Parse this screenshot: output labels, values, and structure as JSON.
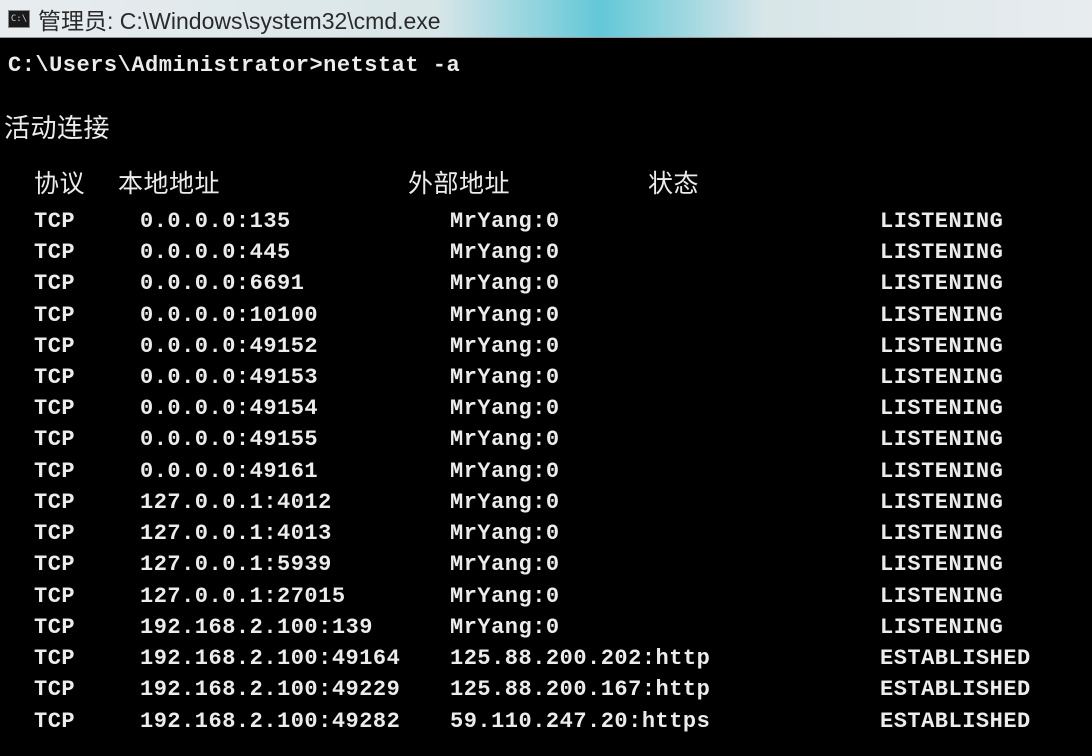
{
  "titlebar": {
    "icon": "C:\\",
    "title": "管理员: C:\\Windows\\system32\\cmd.exe"
  },
  "terminal": {
    "prompt": "C:\\Users\\Administrator>",
    "command": "netstat -a",
    "section_title": "活动连接",
    "headers": {
      "protocol": "协议",
      "local_address": "本地地址",
      "foreign_address": "外部地址",
      "state": "状态"
    },
    "rows": [
      {
        "proto": "TCP",
        "local": "0.0.0.0:135",
        "foreign": "MrYang:0",
        "state": "LISTENING"
      },
      {
        "proto": "TCP",
        "local": "0.0.0.0:445",
        "foreign": "MrYang:0",
        "state": "LISTENING"
      },
      {
        "proto": "TCP",
        "local": "0.0.0.0:6691",
        "foreign": "MrYang:0",
        "state": "LISTENING"
      },
      {
        "proto": "TCP",
        "local": "0.0.0.0:10100",
        "foreign": "MrYang:0",
        "state": "LISTENING"
      },
      {
        "proto": "TCP",
        "local": "0.0.0.0:49152",
        "foreign": "MrYang:0",
        "state": "LISTENING"
      },
      {
        "proto": "TCP",
        "local": "0.0.0.0:49153",
        "foreign": "MrYang:0",
        "state": "LISTENING"
      },
      {
        "proto": "TCP",
        "local": "0.0.0.0:49154",
        "foreign": "MrYang:0",
        "state": "LISTENING"
      },
      {
        "proto": "TCP",
        "local": "0.0.0.0:49155",
        "foreign": "MrYang:0",
        "state": "LISTENING"
      },
      {
        "proto": "TCP",
        "local": "0.0.0.0:49161",
        "foreign": "MrYang:0",
        "state": "LISTENING"
      },
      {
        "proto": "TCP",
        "local": "127.0.0.1:4012",
        "foreign": "MrYang:0",
        "state": "LISTENING"
      },
      {
        "proto": "TCP",
        "local": "127.0.0.1:4013",
        "foreign": "MrYang:0",
        "state": "LISTENING"
      },
      {
        "proto": "TCP",
        "local": "127.0.0.1:5939",
        "foreign": "MrYang:0",
        "state": "LISTENING"
      },
      {
        "proto": "TCP",
        "local": "127.0.0.1:27015",
        "foreign": "MrYang:0",
        "state": "LISTENING"
      },
      {
        "proto": "TCP",
        "local": "192.168.2.100:139",
        "foreign": "MrYang:0",
        "state": "LISTENING"
      },
      {
        "proto": "TCP",
        "local": "192.168.2.100:49164",
        "foreign": "125.88.200.202:http",
        "state": "ESTABLISHED"
      },
      {
        "proto": "TCP",
        "local": "192.168.2.100:49229",
        "foreign": "125.88.200.167:http",
        "state": "ESTABLISHED"
      },
      {
        "proto": "TCP",
        "local": "192.168.2.100:49282",
        "foreign": "59.110.247.20:https",
        "state": "ESTABLISHED"
      }
    ]
  }
}
